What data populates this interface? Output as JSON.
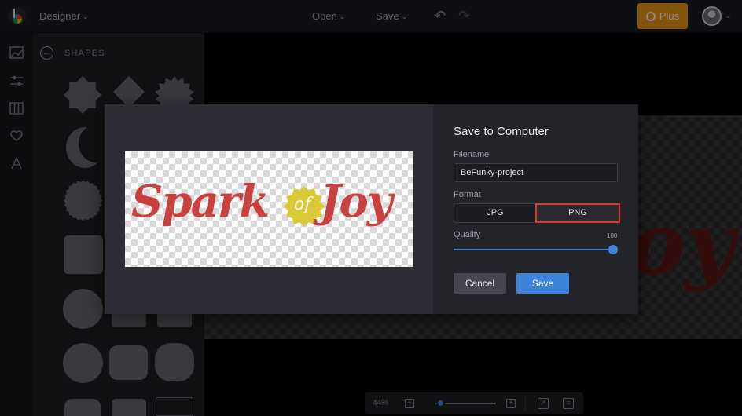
{
  "header": {
    "mode_label": "Designer",
    "open_label": "Open",
    "save_label": "Save",
    "plus_label": "Plus",
    "caret_glyph": "⌄"
  },
  "rail": {
    "icons": [
      "image-icon",
      "sliders-icon",
      "layout-icon",
      "heart-icon",
      "text-icon"
    ]
  },
  "panel": {
    "title": "SHAPES"
  },
  "canvas": {
    "zoom_label": "44%"
  },
  "dialog": {
    "title": "Save to Computer",
    "filename_label": "Filename",
    "filename_value": "BeFunky-project",
    "format_label": "Format",
    "formats": [
      "JPG",
      "PNG"
    ],
    "selected_format": "PNG",
    "quality_label": "Quality",
    "quality_value": "100",
    "cancel_label": "Cancel",
    "save_label": "Save"
  },
  "artwork": {
    "word1": "Spark",
    "connector": "of",
    "word2": "Joy",
    "background_word": "oy",
    "text_color": "#c8413f",
    "badge_color": "#d8c935"
  },
  "colors": {
    "accent": "#3d83d9",
    "plus": "#f39a17",
    "selection_outline": "#e0392b"
  }
}
